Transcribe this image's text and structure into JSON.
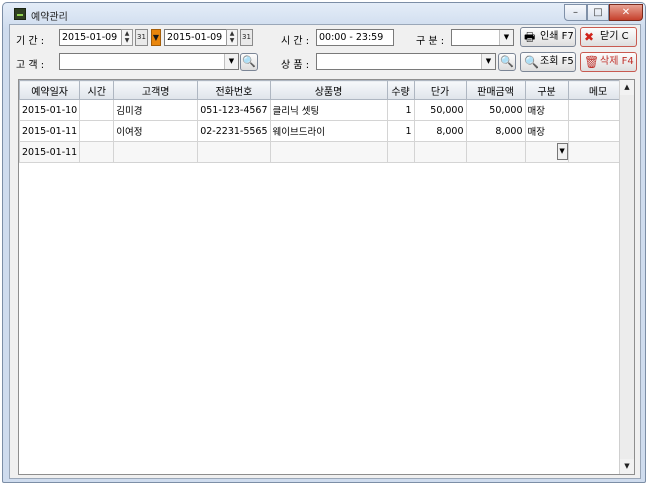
{
  "window": {
    "title": "예약관리",
    "min_glyph": "–",
    "max_glyph": "□",
    "close_glyph": "✕"
  },
  "filters": {
    "period_label": "기 간 :",
    "date_from": "2015-01-09",
    "date_to": "2015-01-09",
    "cal_glyph": "31",
    "range_arrow": "▼",
    "time_label": "시 간 :",
    "time_from": "00:00",
    "time_sep": "-",
    "time_to": "23:59",
    "category_label": "구 분 :",
    "category_value": "",
    "customer_label": "고 객 :",
    "customer_value": "",
    "product_label": "상 품 :",
    "product_value": "",
    "spin_up": "▲",
    "spin_down": "▼",
    "combo_arrow": "▼",
    "search_glyph": "🔍"
  },
  "buttons": {
    "print": "인쇄 F7",
    "close": "닫기 C",
    "query": "조회 F5",
    "delete": "삭제 F4",
    "print_icon": "🖶",
    "close_icon": "✖",
    "query_icon": "🔍",
    "delete_icon": "🗑"
  },
  "grid": {
    "columns": [
      "예약일자",
      "시간",
      "고객명",
      "전화번호",
      "상품명",
      "수량",
      "단가",
      "판매금액",
      "구분",
      "메모"
    ],
    "rows": [
      [
        "2015-01-10",
        "",
        "김미경",
        "051-123-4567",
        "클리닉 셋팅",
        "1",
        "50,000",
        "50,000",
        "매장",
        ""
      ],
      [
        "2015-01-11",
        "",
        "이여정",
        "02-2231-5565",
        "웨이브드라이",
        "1",
        "8,000",
        "8,000",
        "매장",
        ""
      ],
      [
        "2015-01-11",
        "",
        "",
        "",
        "",
        "",
        "",
        "",
        "",
        ""
      ]
    ],
    "scroll_up": "▲",
    "scroll_down": "▼",
    "cell_drop": "▼"
  }
}
